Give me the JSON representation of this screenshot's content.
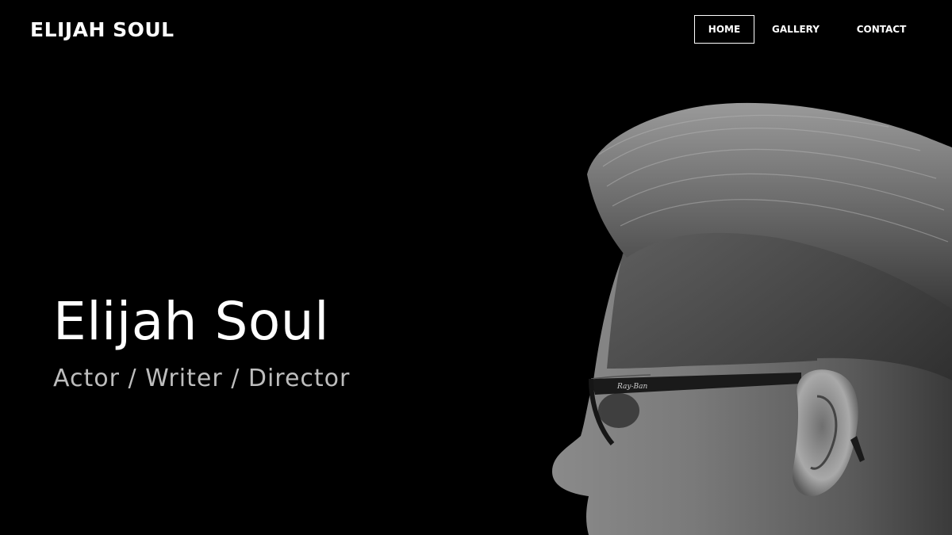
{
  "header": {
    "brand": "ELIJAH SOUL",
    "nav": [
      {
        "label": "HOME",
        "active": true
      },
      {
        "label": "GALLERY",
        "active": false
      },
      {
        "label": "CONTACT",
        "active": false
      }
    ]
  },
  "hero": {
    "title": "Elijah Soul",
    "subtitle": "Actor / Writer / Director",
    "image": {
      "subject": "black-and-white profile portrait of a man with swept-back hair and glasses"
    }
  },
  "colors": {
    "background": "#000000",
    "text": "#ffffff",
    "subtitle": "#bdbdbd"
  }
}
